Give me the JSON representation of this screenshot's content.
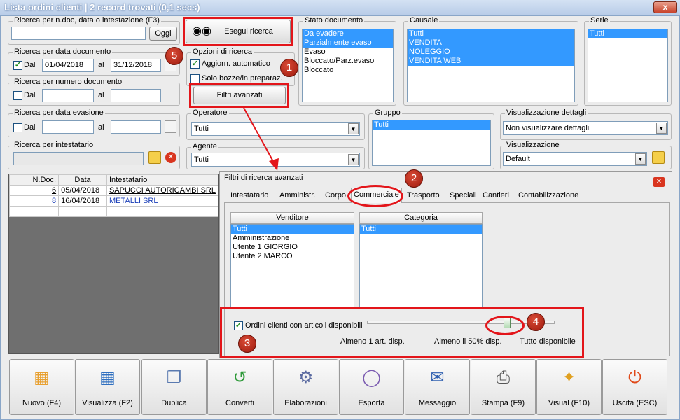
{
  "window": {
    "title": "Lista ordini clienti | 2 record trovati (0,1 secs)",
    "close": "x"
  },
  "search_ndoc": {
    "label": "Ricerca per n.doc, data o intestazione (F3)",
    "value": "",
    "today_btn": "Oggi"
  },
  "search_btn": {
    "label": "Esegui ricerca"
  },
  "date_doc": {
    "label": "Ricerca per data documento",
    "dal": "Dal",
    "from": "01/04/2018",
    "al": "al",
    "to": "31/12/2018",
    "checked": true
  },
  "num_doc": {
    "label": "Ricerca per numero documento",
    "dal": "Dal",
    "al": "al"
  },
  "date_ev": {
    "label": "Ricerca per data evasione",
    "dal": "Dal",
    "al": "al"
  },
  "intest": {
    "label": "Ricerca per intestatario"
  },
  "options": {
    "label": "Opzioni di ricerca",
    "auto": "Aggiorn. automatico",
    "auto_checked": true,
    "drafts": "Solo bozze/in preparaz.",
    "adv_btn": "Filtri avanzati"
  },
  "stato": {
    "label": "Stato documento",
    "items": [
      "Da evadere",
      "Parzialmente evaso",
      "Evaso",
      "Bloccato/Parz.evaso",
      "Bloccato"
    ],
    "selected": [
      0,
      1
    ]
  },
  "causale": {
    "label": "Causale",
    "items": [
      "Tutti",
      "VENDITA",
      "NOLEGGIO",
      "VENDITA WEB"
    ]
  },
  "serie": {
    "label": "Serie",
    "items": [
      "Tutti"
    ]
  },
  "operatore": {
    "label": "Operatore",
    "value": "Tutti"
  },
  "agente": {
    "label": "Agente",
    "value": "Tutti"
  },
  "gruppo": {
    "label": "Gruppo",
    "items": [
      "Tutti"
    ]
  },
  "vis_dett": {
    "label": "Visualizzazione dettagli",
    "value": "Non visualizzare dettagli"
  },
  "vis": {
    "label": "Visualizzazione",
    "value": "Default"
  },
  "grid": {
    "columns": [
      "",
      "N.Doc.",
      "Data",
      "Intestatario"
    ],
    "rows": [
      {
        "n": "6",
        "date": "05/04/2018",
        "name": "SAPUCCI AUTORICAMBI SRL"
      },
      {
        "n": "8",
        "date": "16/04/2018",
        "name": "METALLI SRL"
      }
    ]
  },
  "adv": {
    "title": "Filtri di ricerca avanzati",
    "tabs": [
      "Intestatario",
      "Amministr.",
      "Corpo",
      "Commerciale",
      "Trasporto",
      "Speciali",
      "Cantieri",
      "Contabilizzazione"
    ],
    "active_tab": "Commerciale",
    "venditore": {
      "label": "Venditore",
      "items": [
        "Tutti",
        "Amministrazione",
        "Utente 1 GIORGIO",
        "Utente 2 MARCO"
      ]
    },
    "categoria": {
      "label": "Categoria",
      "items": [
        "Tutti"
      ]
    },
    "avail": {
      "label": "Ordini clienti con articoli disponibili",
      "checked": true,
      "min": "Almeno 1 art. disp.",
      "half": "Almeno il 50% disp.",
      "all": "Tutto disponibile"
    }
  },
  "toolbar": [
    {
      "label": "Nuovo (F4)",
      "icon": "new-grid-icon"
    },
    {
      "label": "Visualizza (F2)",
      "icon": "view-grid-icon"
    },
    {
      "label": "Duplica",
      "icon": "duplicate-icon"
    },
    {
      "label": "Converti",
      "icon": "convert-icon"
    },
    {
      "label": "Elaborazioni",
      "icon": "process-icon"
    },
    {
      "label": "Esporta",
      "icon": "database-icon"
    },
    {
      "label": "Messaggio",
      "icon": "mail-icon"
    },
    {
      "label": "Stampa (F9)",
      "icon": "printer-icon"
    },
    {
      "label": "Visual (F10)",
      "icon": "wand-icon"
    },
    {
      "label": "Uscita (ESC)",
      "icon": "power-icon"
    }
  ],
  "badges": [
    "1",
    "2",
    "3",
    "4",
    "5"
  ]
}
